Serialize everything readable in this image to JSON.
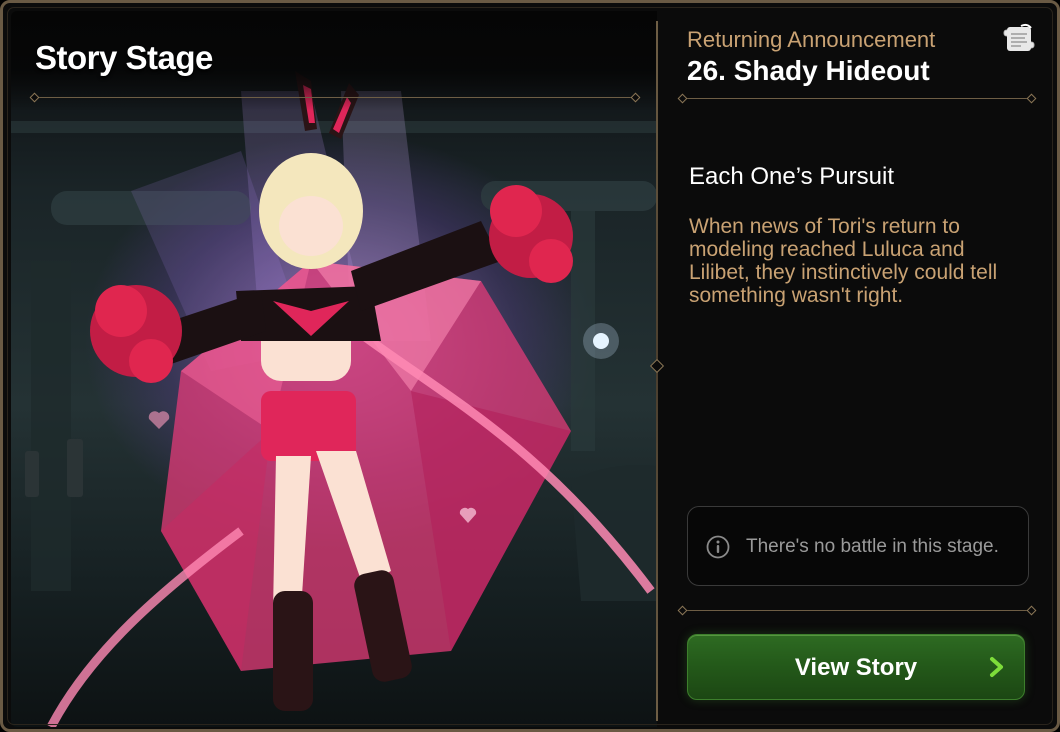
{
  "left_panel": {
    "title": "Story Stage"
  },
  "right_panel": {
    "announcement_label": "Returning Announcement",
    "stage_name": "26. Shady Hideout",
    "chapter_title": "Each One’s Pursuit",
    "chapter_description": "When news of Tori's return to modeling reached Luluca and Lilibet, they instinctively could tell something wasn't right.",
    "notice": {
      "icon": "info-icon",
      "text": "There's no battle in this stage."
    },
    "view_button": {
      "label": "View Story",
      "icon": "chevron-right-icon"
    },
    "scroll_icon": "scroll-icon"
  },
  "colors": {
    "accent_gold": "#c9a273",
    "button_green": "#2e6b22",
    "arrow_green": "#7ddc3a",
    "frame_border": "#6a5a44"
  }
}
